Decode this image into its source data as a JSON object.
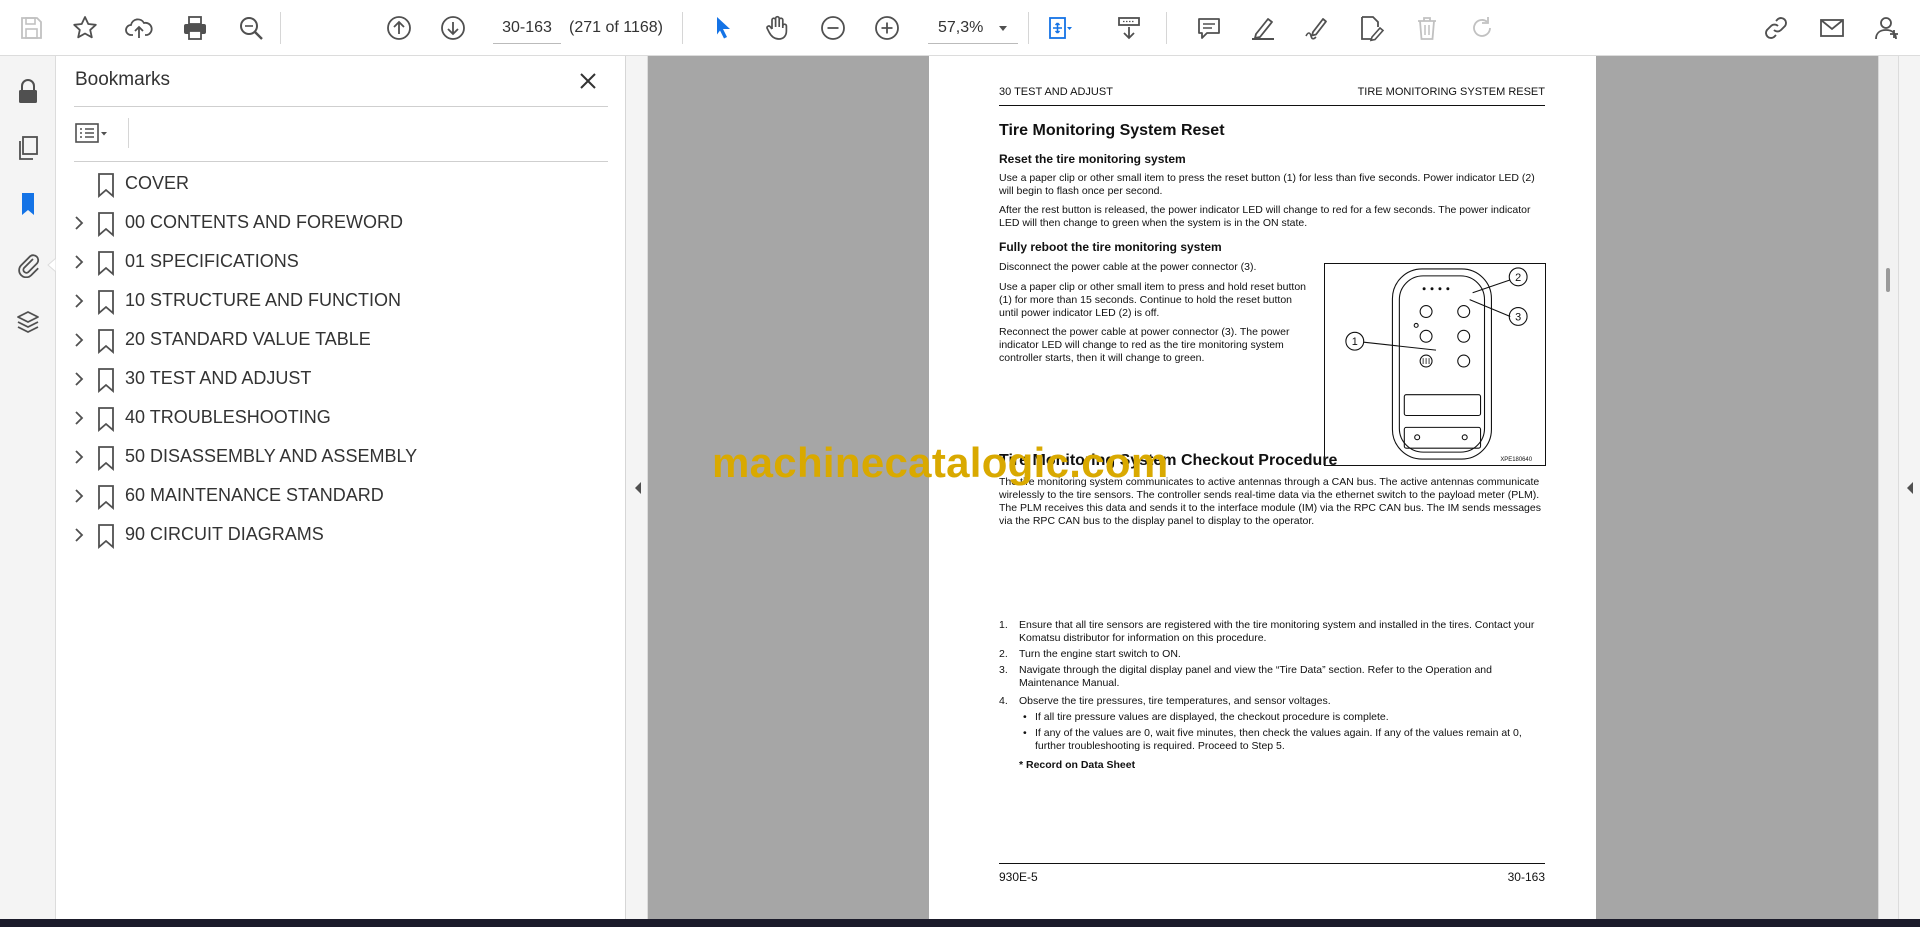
{
  "toolbar": {
    "page_input": "30-163",
    "page_count": "(271 of 1168)",
    "zoom": "57,3%"
  },
  "bookmarks_panel": {
    "title": "Bookmarks",
    "items": [
      {
        "label": "COVER",
        "expandable": false
      },
      {
        "label": "00 CONTENTS AND FOREWORD",
        "expandable": true
      },
      {
        "label": "01 SPECIFICATIONS",
        "expandable": true
      },
      {
        "label": "10 STRUCTURE AND FUNCTION",
        "expandable": true
      },
      {
        "label": "20 STANDARD VALUE TABLE",
        "expandable": true
      },
      {
        "label": "30 TEST AND ADJUST",
        "expandable": true
      },
      {
        "label": "40 TROUBLESHOOTING",
        "expandable": true
      },
      {
        "label": "50 DISASSEMBLY AND ASSEMBLY",
        "expandable": true
      },
      {
        "label": "60 MAINTENANCE STANDARD",
        "expandable": true
      },
      {
        "label": "90 CIRCUIT DIAGRAMS",
        "expandable": true
      }
    ]
  },
  "document": {
    "header_left": "30 TEST AND ADJUST",
    "header_right": "TIRE MONITORING SYSTEM RESET",
    "section1_title": "Tire Monitoring System Reset",
    "sub1_title": "Reset the tire monitoring system",
    "sub1_p1": "Use a paper clip or other small item to press the reset button (1) for less than five seconds. Power indicator LED (2) will begin to flash once per second.",
    "sub1_p2": "After the rest button is released, the power indicator LED will change to red for a few seconds. The power indicator LED will then change to green when the system is in the ON state.",
    "sub2_title": "Fully reboot the tire monitoring system",
    "sub2_p1": "Disconnect the power cable at the power connector (3).",
    "sub2_p2": "Use a paper clip or other small item to press and hold reset button (1) for more than 15 seconds. Continue to hold the reset button until power indicator LED (2) is off.",
    "sub2_p3": "Reconnect the power cable at power connector (3). The power indicator LED will change to red as the tire monitoring system controller starts, then it will change to green.",
    "figure_callouts": [
      "1",
      "2",
      "3"
    ],
    "figure_code": "XPE180640",
    "section2_title": "Tire Monitoring System Checkout Procedure",
    "section2_intro": "The tire monitoring system communicates to active antennas through a CAN bus. The active antennas communicate wirelessly to the tire sensors. The controller sends real-time data via the ethernet switch to the payload meter (PLM). The PLM receives this data and sends it to the interface module (IM) via the RPC CAN bus. The IM sends messages via the RPC CAN bus to the display panel to display to the operator.",
    "steps": [
      {
        "num": "1.",
        "text": "Ensure that all tire sensors are registered with the tire monitoring system and installed in the tires. Contact your Komatsu distributor for information on this procedure."
      },
      {
        "num": "2.",
        "text": "Turn the engine start switch to ON."
      },
      {
        "num": "3.",
        "text": "Navigate through the digital display panel and view the “Tire Data” section. Refer to the Operation and Maintenance Manual."
      },
      {
        "num": "4.",
        "text": "Observe the tire pressures, tire temperatures, and sensor voltages."
      }
    ],
    "bullets": [
      "If all tire pressure values are displayed, the checkout procedure is complete.",
      "If any of the values are 0, wait five minutes, then check the values again. If any of the values remain at 0, further troubleshooting is required. Proceed to Step 5."
    ],
    "record_note": "* Record on Data Sheet",
    "footer_left": "930E-5",
    "footer_right": "30-163"
  },
  "watermark": "machinecatalogic.com",
  "colors": {
    "accent_blue": "#1473e6",
    "icon_gray": "#505050",
    "doc_background": "#a6a6a6",
    "watermark": "#d9a900"
  }
}
